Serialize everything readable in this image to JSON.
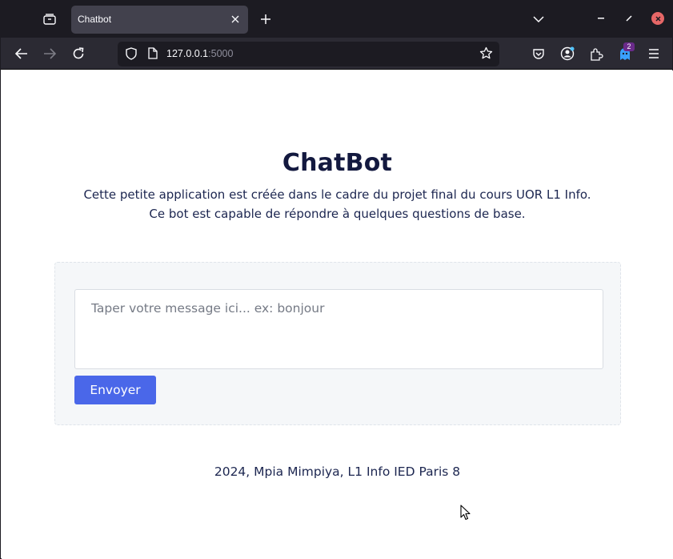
{
  "browser": {
    "tab": {
      "title": "Chatbot"
    },
    "url": {
      "host": "127.0.0.1",
      "port": ":5000"
    },
    "extension_badge": "2",
    "icons": {
      "tab_manager": "tab-manager-icon",
      "close_tab": "close-icon",
      "new_tab": "plus-icon",
      "list_tabs": "chevron-down-icon",
      "back": "back-arrow-icon",
      "forward": "forward-arrow-icon",
      "reload": "reload-icon",
      "bookmark": "star-icon"
    }
  },
  "page": {
    "title": "ChatBot",
    "subtitle_line1": "Cette petite application est créée dans le cadre du projet final du cours UOR L1 Info.",
    "subtitle_line2": "Ce bot est capable de répondre à quelques questions de base.",
    "message_placeholder": "Taper votre message ici... ex: bonjour",
    "message_value": "",
    "send_label": "Envoyer",
    "footer": "2024, Mpia Mimpiya, L1 Info IED Paris 8"
  },
  "colors": {
    "title": "#13193f",
    "button": "#4a67e9",
    "card_bg": "#f5f7f9",
    "chrome_dark": "#1c1b22",
    "toolbar": "#2b2a33"
  }
}
